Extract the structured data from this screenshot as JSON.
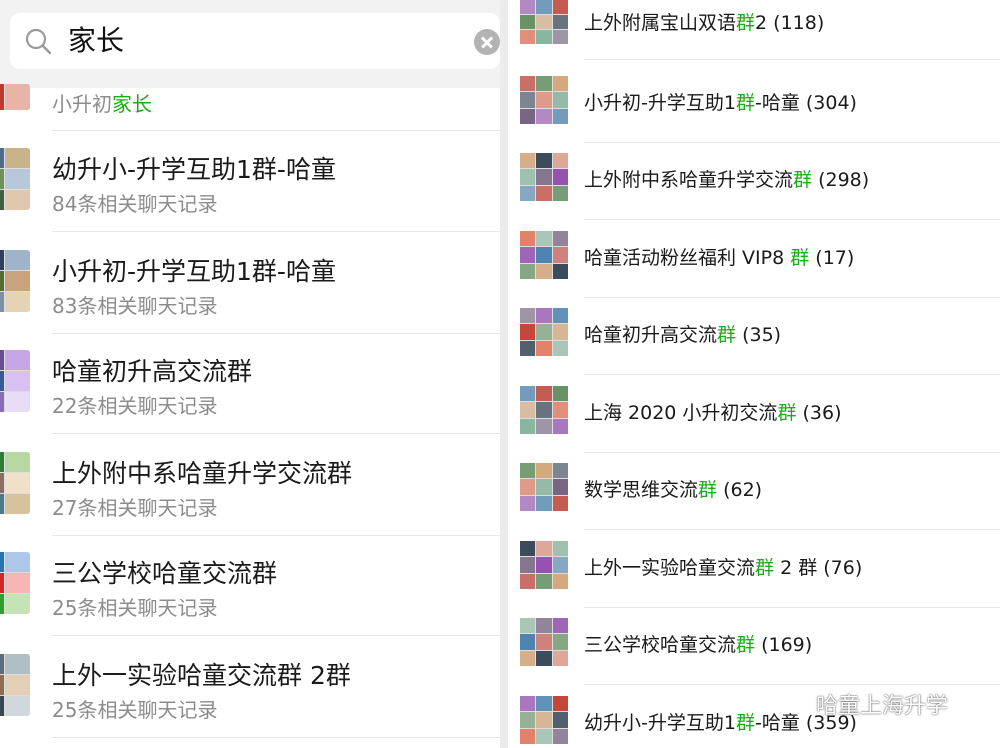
{
  "search": {
    "query": "家长"
  },
  "left_list": [
    {
      "title": "",
      "sub_prefix": "小升初",
      "sub_highlight": "家长",
      "sub_suffix": ""
    },
    {
      "title": "幼升小-升学互助1群-哈童",
      "sub_prefix": "84条相关聊天记录",
      "sub_highlight": "",
      "sub_suffix": ""
    },
    {
      "title": "小升初-升学互助1群-哈童",
      "sub_prefix": "83条相关聊天记录",
      "sub_highlight": "",
      "sub_suffix": ""
    },
    {
      "title": "哈童初升高交流群",
      "sub_prefix": "22条相关聊天记录",
      "sub_highlight": "",
      "sub_suffix": ""
    },
    {
      "title": "上外附中系哈童升学交流群",
      "sub_prefix": "27条相关聊天记录",
      "sub_highlight": "",
      "sub_suffix": ""
    },
    {
      "title": "三公学校哈童交流群",
      "sub_prefix": "25条相关聊天记录",
      "sub_highlight": "",
      "sub_suffix": ""
    },
    {
      "title": "上外一实验哈童交流群 2群",
      "sub_prefix": "25条相关聊天记录",
      "sub_highlight": "",
      "sub_suffix": ""
    }
  ],
  "right_list": [
    {
      "pre": "上外附属宝山双语",
      "hl": "群",
      "post": "2 (118)"
    },
    {
      "pre": "小升初-升学互助1",
      "hl": "群",
      "post": "-哈童 (304)"
    },
    {
      "pre": "上外附中系哈童升学交流",
      "hl": "群",
      "post": " (298)"
    },
    {
      "pre": "哈童活动粉丝福利 VIP8 ",
      "hl": "群",
      "post": " (17)"
    },
    {
      "pre": "哈童初升高交流",
      "hl": "群",
      "post": " (35)"
    },
    {
      "pre": "上海 2020 小升初交流",
      "hl": "群",
      "post": " (36)"
    },
    {
      "pre": "数学思维交流",
      "hl": "群",
      "post": " (62)"
    },
    {
      "pre": "上外一实验哈童交流",
      "hl": "群",
      "post": " 2 群 (76)"
    },
    {
      "pre": "三公学校哈童交流",
      "hl": "群",
      "post": " (169)"
    },
    {
      "pre": "幼升小-升学互助1",
      "hl": "群",
      "post": "-哈童 (359)"
    }
  ],
  "watermark": {
    "text": "哈童上海升学"
  },
  "colors": {
    "highlight": "#1aad19",
    "divider": "#e6e6e6",
    "subtext": "#8c8c8c"
  }
}
